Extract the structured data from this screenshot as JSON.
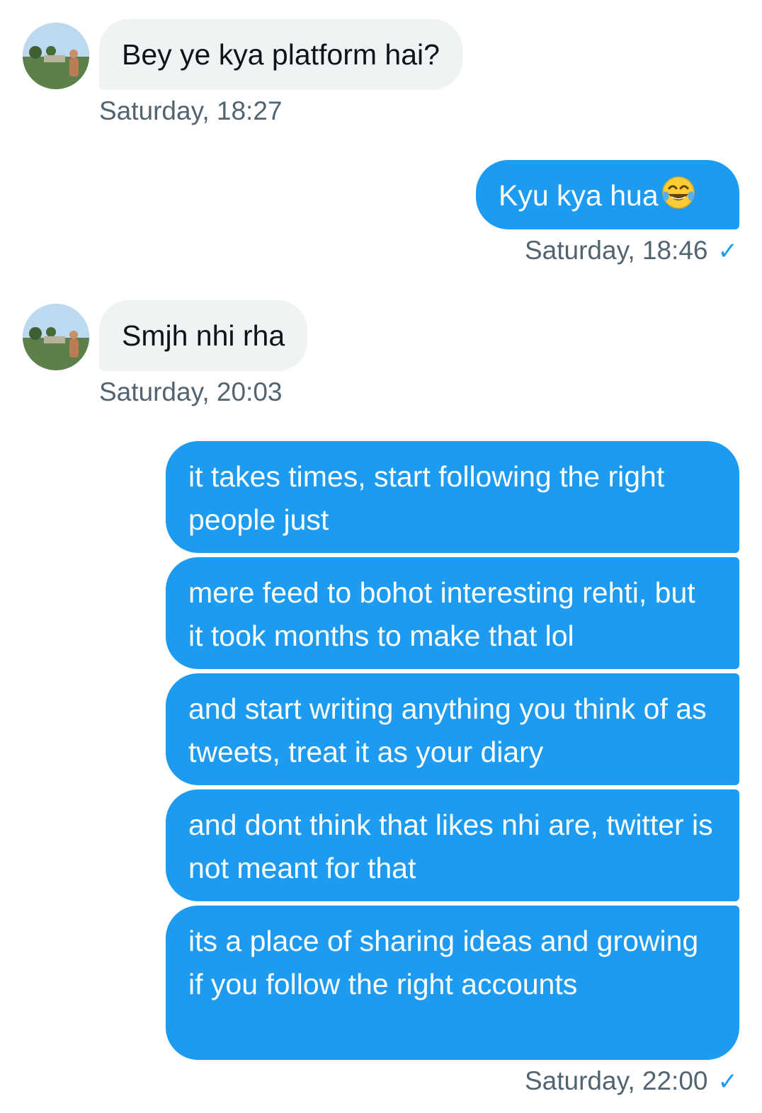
{
  "messages": [
    {
      "direction": "in",
      "text": "Bey ye kya platform hai?",
      "time": "Saturday, 18:27"
    },
    {
      "direction": "out",
      "text": "Kyu kya hua",
      "emoji": "tears-of-joy",
      "time": "Saturday, 18:46",
      "status_icon": "checkmark-icon"
    },
    {
      "direction": "in",
      "text": "Smjh nhi rha",
      "time": "Saturday, 20:03"
    },
    {
      "direction": "out",
      "text": "it takes times, start following the right people just"
    },
    {
      "direction": "out",
      "text": "mere feed to bohot interesting rehti, but it took months to make that lol"
    },
    {
      "direction": "out",
      "text": "and start writing anything you think of as tweets, treat it as your diary"
    },
    {
      "direction": "out",
      "text": "and dont think that likes nhi are, twitter is not meant for that"
    },
    {
      "direction": "out",
      "text": "its a place of sharing ideas and growing if you follow the right accounts",
      "time": "Saturday, 22:00",
      "status_icon": "checkmark-icon"
    }
  ],
  "colors": {
    "outgoing_bubble": "#1d9bf0",
    "incoming_bubble": "#eff3f4",
    "timestamp": "#536471",
    "checkmark": "#1d9bf0"
  },
  "icons": {
    "check_glyph": "✓"
  }
}
